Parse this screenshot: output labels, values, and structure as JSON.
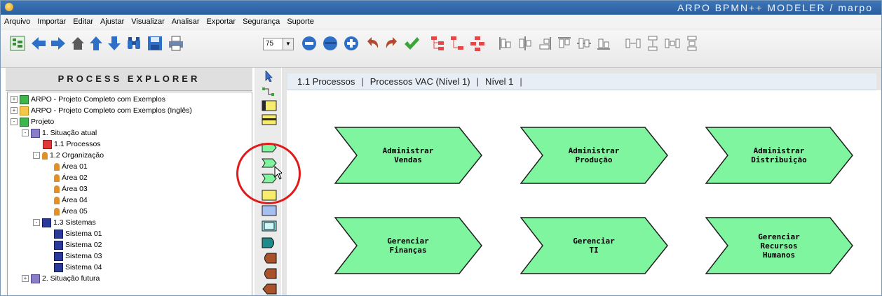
{
  "window": {
    "title": "ARPO BPMN++ MODELER / marpo"
  },
  "menu": [
    "Arquivo",
    "Importar",
    "Editar",
    "Ajustar",
    "Visualizar",
    "Analisar",
    "Exportar",
    "Segurança",
    "Suporte"
  ],
  "toolbar": {
    "zoom_value": "75"
  },
  "explorer": {
    "title": "PROCESS EXPLORER",
    "nodes": [
      {
        "label": "ARPO - Projeto Completo com Exemplos",
        "icon": "project-icon",
        "expander": "+"
      },
      {
        "label": "ARPO - Projeto Completo com Exemplos (Inglês)",
        "icon": "project-icon",
        "expander": "+"
      },
      {
        "label": "Projeto",
        "icon": "project-icon",
        "expander": "-"
      },
      {
        "label": "1. Situação atual",
        "icon": "folder-icon",
        "expander": "-"
      },
      {
        "label": "1.1 Processos",
        "icon": "process-icon",
        "expander": ""
      },
      {
        "label": "1.2 Organização",
        "icon": "organization-icon",
        "expander": "-"
      },
      {
        "label": "Área 01",
        "icon": "person-icon",
        "expander": ""
      },
      {
        "label": "Área 02",
        "icon": "person-icon",
        "expander": ""
      },
      {
        "label": "Área 03",
        "icon": "person-icon",
        "expander": ""
      },
      {
        "label": "Área 04",
        "icon": "person-icon",
        "expander": ""
      },
      {
        "label": "Área 05",
        "icon": "person-icon",
        "expander": ""
      },
      {
        "label": "1.3 Sistemas",
        "icon": "computer-icon",
        "expander": "-"
      },
      {
        "label": "Sistema 01",
        "icon": "computer-icon",
        "expander": ""
      },
      {
        "label": "Sistema 02",
        "icon": "computer-icon",
        "expander": ""
      },
      {
        "label": "Sistema 03",
        "icon": "computer-icon",
        "expander": ""
      },
      {
        "label": "Sistema 04",
        "icon": "computer-icon",
        "expander": ""
      },
      {
        "label": "2. Situação futura",
        "icon": "folder-icon",
        "expander": "+"
      }
    ]
  },
  "breadcrumb": [
    "1.1 Processos",
    "Processos VAC (Nível 1)",
    "Nível 1"
  ],
  "processes": [
    {
      "label": "Administrar\nVendas"
    },
    {
      "label": "Administrar\nProdução"
    },
    {
      "label": "Administrar\nDistribuição"
    },
    {
      "label": "Gerenciar\nFinanças"
    },
    {
      "label": "Gerenciar\nTI"
    },
    {
      "label": "Gerenciar\nRecursos\nHumanos"
    }
  ],
  "colors": {
    "process_fill": "#7ff59f",
    "process_stroke": "#1e1e1e",
    "highlight": "#e01b1b",
    "titlebar": "#2f67a8"
  }
}
